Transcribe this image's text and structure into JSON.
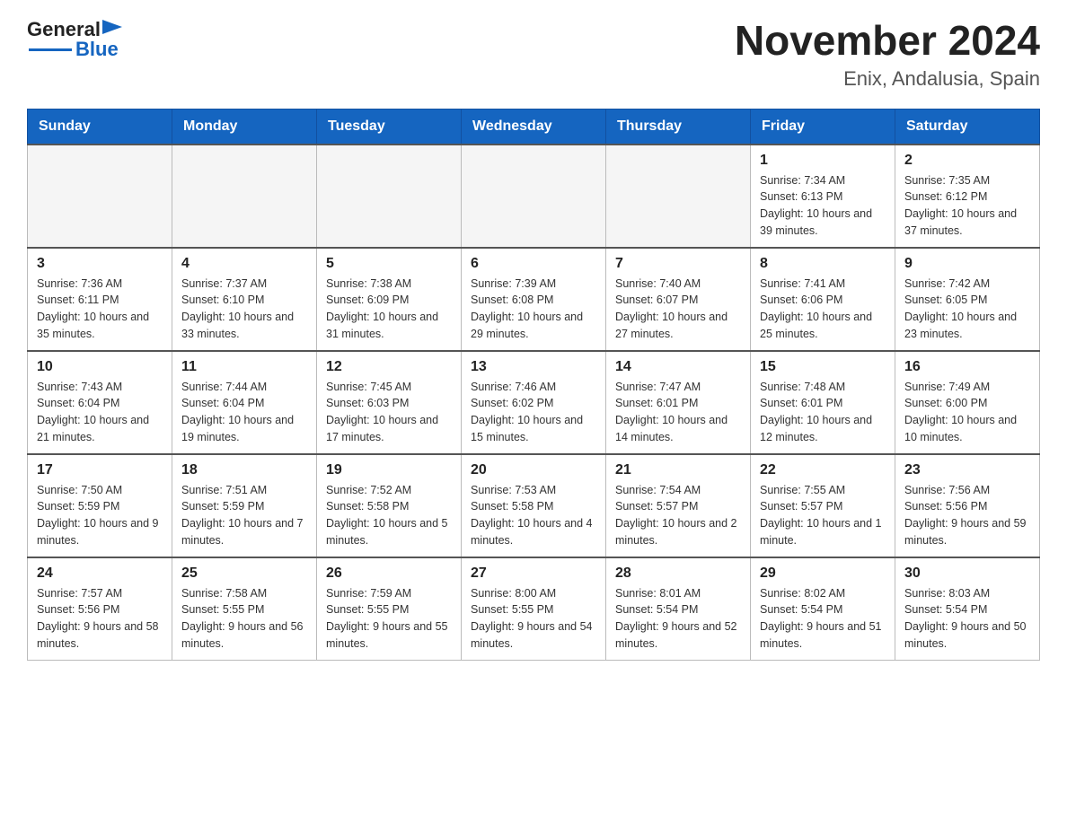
{
  "header": {
    "title": "November 2024",
    "subtitle": "Enix, Andalusia, Spain"
  },
  "logo": {
    "general": "General",
    "blue": "Blue"
  },
  "days_of_week": [
    "Sunday",
    "Monday",
    "Tuesday",
    "Wednesday",
    "Thursday",
    "Friday",
    "Saturday"
  ],
  "weeks": [
    {
      "cells": [
        {
          "day": null
        },
        {
          "day": null
        },
        {
          "day": null
        },
        {
          "day": null
        },
        {
          "day": null
        },
        {
          "day": 1,
          "sunrise": "7:34 AM",
          "sunset": "6:13 PM",
          "daylight": "10 hours and 39 minutes."
        },
        {
          "day": 2,
          "sunrise": "7:35 AM",
          "sunset": "6:12 PM",
          "daylight": "10 hours and 37 minutes."
        }
      ]
    },
    {
      "cells": [
        {
          "day": 3,
          "sunrise": "7:36 AM",
          "sunset": "6:11 PM",
          "daylight": "10 hours and 35 minutes."
        },
        {
          "day": 4,
          "sunrise": "7:37 AM",
          "sunset": "6:10 PM",
          "daylight": "10 hours and 33 minutes."
        },
        {
          "day": 5,
          "sunrise": "7:38 AM",
          "sunset": "6:09 PM",
          "daylight": "10 hours and 31 minutes."
        },
        {
          "day": 6,
          "sunrise": "7:39 AM",
          "sunset": "6:08 PM",
          "daylight": "10 hours and 29 minutes."
        },
        {
          "day": 7,
          "sunrise": "7:40 AM",
          "sunset": "6:07 PM",
          "daylight": "10 hours and 27 minutes."
        },
        {
          "day": 8,
          "sunrise": "7:41 AM",
          "sunset": "6:06 PM",
          "daylight": "10 hours and 25 minutes."
        },
        {
          "day": 9,
          "sunrise": "7:42 AM",
          "sunset": "6:05 PM",
          "daylight": "10 hours and 23 minutes."
        }
      ]
    },
    {
      "cells": [
        {
          "day": 10,
          "sunrise": "7:43 AM",
          "sunset": "6:04 PM",
          "daylight": "10 hours and 21 minutes."
        },
        {
          "day": 11,
          "sunrise": "7:44 AM",
          "sunset": "6:04 PM",
          "daylight": "10 hours and 19 minutes."
        },
        {
          "day": 12,
          "sunrise": "7:45 AM",
          "sunset": "6:03 PM",
          "daylight": "10 hours and 17 minutes."
        },
        {
          "day": 13,
          "sunrise": "7:46 AM",
          "sunset": "6:02 PM",
          "daylight": "10 hours and 15 minutes."
        },
        {
          "day": 14,
          "sunrise": "7:47 AM",
          "sunset": "6:01 PM",
          "daylight": "10 hours and 14 minutes."
        },
        {
          "day": 15,
          "sunrise": "7:48 AM",
          "sunset": "6:01 PM",
          "daylight": "10 hours and 12 minutes."
        },
        {
          "day": 16,
          "sunrise": "7:49 AM",
          "sunset": "6:00 PM",
          "daylight": "10 hours and 10 minutes."
        }
      ]
    },
    {
      "cells": [
        {
          "day": 17,
          "sunrise": "7:50 AM",
          "sunset": "5:59 PM",
          "daylight": "10 hours and 9 minutes."
        },
        {
          "day": 18,
          "sunrise": "7:51 AM",
          "sunset": "5:59 PM",
          "daylight": "10 hours and 7 minutes."
        },
        {
          "day": 19,
          "sunrise": "7:52 AM",
          "sunset": "5:58 PM",
          "daylight": "10 hours and 5 minutes."
        },
        {
          "day": 20,
          "sunrise": "7:53 AM",
          "sunset": "5:58 PM",
          "daylight": "10 hours and 4 minutes."
        },
        {
          "day": 21,
          "sunrise": "7:54 AM",
          "sunset": "5:57 PM",
          "daylight": "10 hours and 2 minutes."
        },
        {
          "day": 22,
          "sunrise": "7:55 AM",
          "sunset": "5:57 PM",
          "daylight": "10 hours and 1 minute."
        },
        {
          "day": 23,
          "sunrise": "7:56 AM",
          "sunset": "5:56 PM",
          "daylight": "9 hours and 59 minutes."
        }
      ]
    },
    {
      "cells": [
        {
          "day": 24,
          "sunrise": "7:57 AM",
          "sunset": "5:56 PM",
          "daylight": "9 hours and 58 minutes."
        },
        {
          "day": 25,
          "sunrise": "7:58 AM",
          "sunset": "5:55 PM",
          "daylight": "9 hours and 56 minutes."
        },
        {
          "day": 26,
          "sunrise": "7:59 AM",
          "sunset": "5:55 PM",
          "daylight": "9 hours and 55 minutes."
        },
        {
          "day": 27,
          "sunrise": "8:00 AM",
          "sunset": "5:55 PM",
          "daylight": "9 hours and 54 minutes."
        },
        {
          "day": 28,
          "sunrise": "8:01 AM",
          "sunset": "5:54 PM",
          "daylight": "9 hours and 52 minutes."
        },
        {
          "day": 29,
          "sunrise": "8:02 AM",
          "sunset": "5:54 PM",
          "daylight": "9 hours and 51 minutes."
        },
        {
          "day": 30,
          "sunrise": "8:03 AM",
          "sunset": "5:54 PM",
          "daylight": "9 hours and 50 minutes."
        }
      ]
    }
  ],
  "labels": {
    "sunrise": "Sunrise:",
    "sunset": "Sunset:",
    "daylight": "Daylight:"
  }
}
